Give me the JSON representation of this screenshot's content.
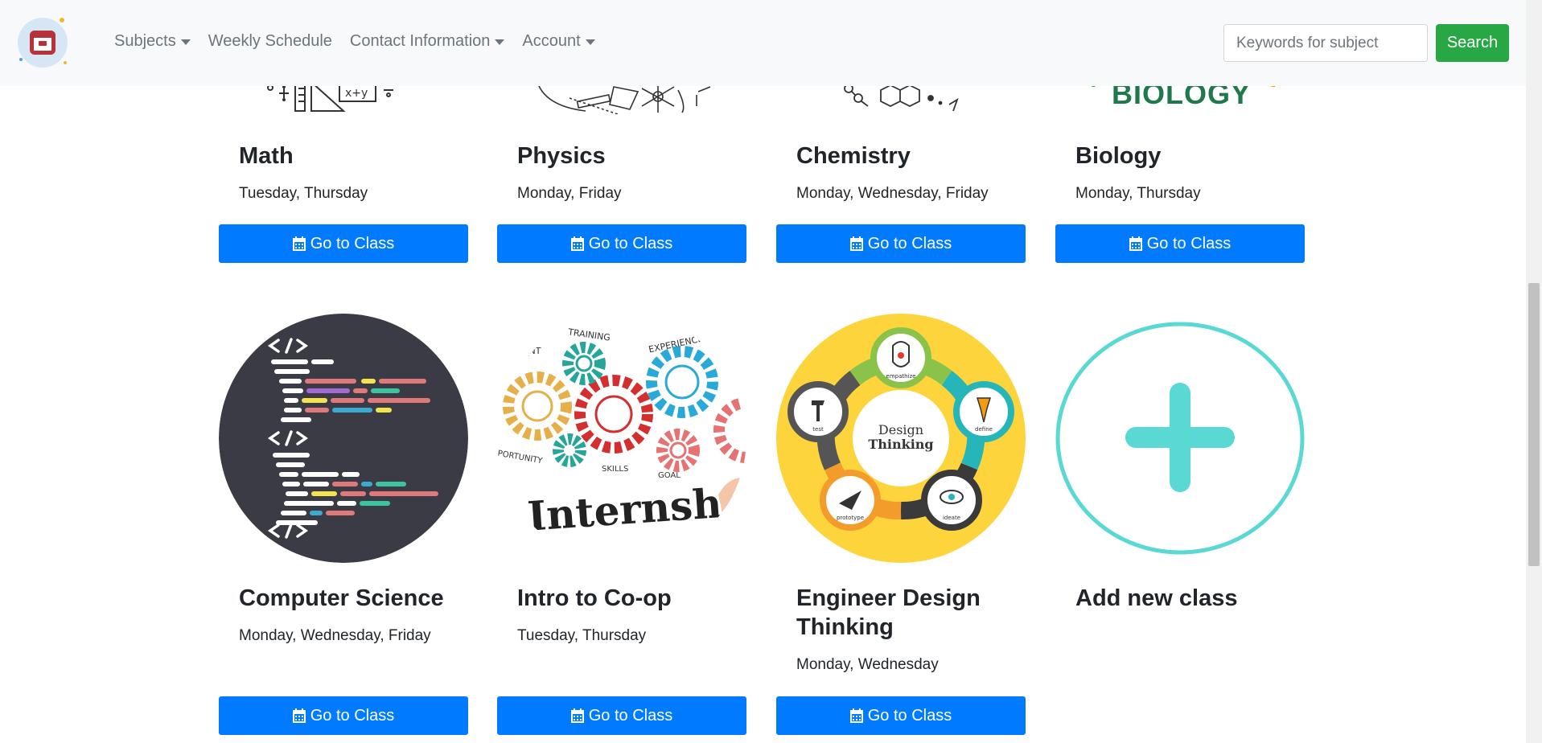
{
  "navbar": {
    "links": [
      {
        "label": "Subjects",
        "dropdown": true
      },
      {
        "label": "Weekly Schedule",
        "dropdown": false
      },
      {
        "label": "Contact Information",
        "dropdown": true
      },
      {
        "label": "Account",
        "dropdown": true
      }
    ],
    "search_placeholder": "Keywords for subject",
    "search_label": "Search",
    "search_color": "#28a745"
  },
  "go_label": "Go to Class",
  "button_color": "#007bff",
  "row1": [
    {
      "title": "Math",
      "days": "Tuesday, Thursday",
      "image": "math-sketch-image"
    },
    {
      "title": "Physics",
      "days": "Monday, Friday",
      "image": "physics-sketch-image"
    },
    {
      "title": "Chemistry",
      "days": "Monday, Wednesday, Friday",
      "image": "chemistry-sketch-image"
    },
    {
      "title": "Biology",
      "days": "Monday, Thursday",
      "image": "biology-logo-image",
      "image_text": "BIOLOGY"
    }
  ],
  "row2": [
    {
      "title": "Computer Science",
      "days": "Monday, Wednesday, Friday",
      "image": "code-icon"
    },
    {
      "title": "Intro to Co-op",
      "days": "Tuesday, Thursday",
      "image": "internship-gears-image",
      "image_text": {
        "main": "Internship",
        "training": "TRAINING",
        "experience": "EXPERIENCE",
        "skills": "SKILLS",
        "goal": "GOAL",
        "opportunity": "PORTUNITY",
        "nt": "_NT"
      }
    },
    {
      "title": "Engineer Design Thinking",
      "days": "Monday, Wednesday",
      "image": "design-thinking-image",
      "image_text": {
        "center1": "Design",
        "center2": "Thinking",
        "s1": "empathize",
        "s2": "define",
        "s3": "ideate",
        "s4": "prototype",
        "s5": "test"
      }
    }
  ],
  "add_card": {
    "title": "Add new class",
    "icon": "plus-icon",
    "color": "#5ad8d4"
  }
}
